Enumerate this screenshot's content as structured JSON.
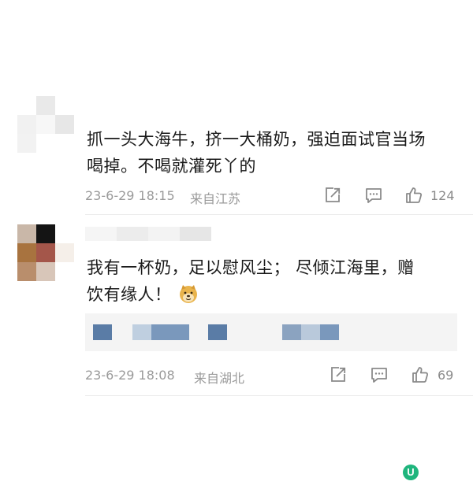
{
  "comments": [
    {
      "text_line1": "抓一头大海牛，挤一大桶奶，强迫面试官当场",
      "text_line2": "喝掉。不喝就灌死丫的",
      "time": "23-6-29 18:15",
      "location": "来自江苏",
      "likes": "124",
      "icons": [
        "share-icon",
        "comment-icon",
        "like-icon"
      ]
    },
    {
      "text_line1": "我有一杯奶，足以慰风尘；  尽倾江海里，赠",
      "text_line2": "饮有缘人！",
      "emoji": "doge-emoji",
      "time": "23-6-29 18:08",
      "location": "来自湖北",
      "likes": "69",
      "icons": [
        "share-icon",
        "comment-icon",
        "like-icon"
      ]
    }
  ],
  "colors": {
    "meta_text": "#9a9a9a",
    "divider": "#ececec",
    "reply_bg": "#f4f4f4",
    "blur_blue": "#5b7fa8",
    "watermark_green": "#1fb57d"
  },
  "watermark": {
    "glyph": "U"
  }
}
